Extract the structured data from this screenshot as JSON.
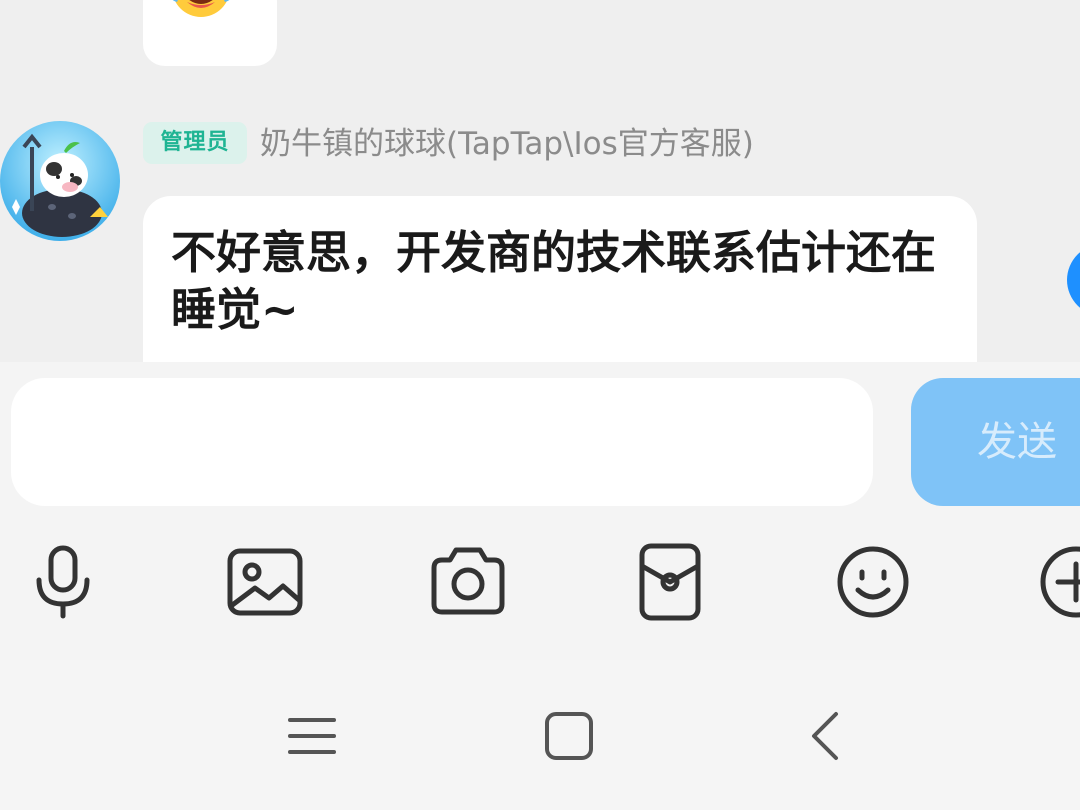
{
  "previous_message": {
    "emoji": "laughing-tears-emoji"
  },
  "message": {
    "role_badge": "管理员",
    "sender_name": "奶牛镇的球球(TapTap\\Ios官方客服)",
    "text": "不好意思，开发商的技术联系估计还在睡觉~"
  },
  "composer": {
    "input_value": "",
    "send_label": "发送"
  },
  "toolbar": {
    "icons": [
      "microphone-icon",
      "image-icon",
      "camera-icon",
      "red-packet-icon",
      "emoji-icon",
      "plus-icon"
    ]
  },
  "navigation": {
    "icons": [
      "menu-icon",
      "home-icon",
      "back-icon"
    ]
  },
  "colors": {
    "accent": "#1e90ff",
    "send_button": "#7fc3f7",
    "badge_text": "#1fb493",
    "badge_bg": "#dcf2ec"
  }
}
